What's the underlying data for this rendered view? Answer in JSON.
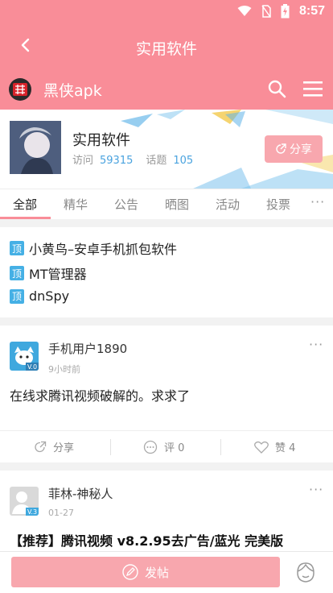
{
  "status_bar": {
    "time": "8:57",
    "icons": [
      "wifi-icon",
      "no-sim-icon",
      "battery-charging-icon"
    ]
  },
  "title_bar": {
    "back_icon": "chevron-left-icon",
    "title": "实用软件"
  },
  "forum_bar": {
    "name": "黑侠apk",
    "logo_icon": "red-seal-logo-icon",
    "search_icon": "search-icon",
    "menu_icon": "hamburger-menu-icon"
  },
  "section": {
    "name": "实用软件",
    "visits_label": "访问",
    "visits": "59315",
    "topics_label": "话题",
    "topics": "105",
    "share_label": "分享"
  },
  "tabs": [
    {
      "label": "全部",
      "active": true
    },
    {
      "label": "精华"
    },
    {
      "label": "公告"
    },
    {
      "label": "晒图"
    },
    {
      "label": "活动"
    },
    {
      "label": "投票"
    }
  ],
  "tabs_more": "···",
  "pinned": {
    "tag": "顶",
    "items": [
      "小黄鸟–安卓手机抓包软件",
      "MT管理器",
      "dnSpy"
    ]
  },
  "posts": [
    {
      "user": "手机用户1890",
      "time": "9小时前",
      "badge": "V.0",
      "text": "在线求腾讯视频破解的。求求了",
      "more": "···",
      "share_label": "分享",
      "comment_label": "评 0",
      "like_label": "赞 4"
    },
    {
      "user": "菲林-神秘人",
      "time": "01-27",
      "badge": "V.3",
      "title": "【推荐】腾讯视频 v8.2.95去广告/蓝光 完美版",
      "more": "···"
    }
  ],
  "bottom_bar": {
    "post_label": "发帖",
    "post_icon": "edit-icon",
    "me_icon": "person-face-icon"
  },
  "colors": {
    "brand": "#f98d98",
    "button": "#f8a7ae",
    "accent_blue": "#4aa3df",
    "pin_tag": "#45b0e5"
  }
}
